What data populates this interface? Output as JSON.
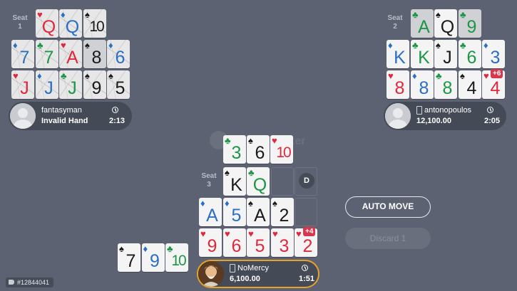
{
  "colors": {
    "table": "#5d6272",
    "red": "#e0283d",
    "black": "#1a1a1a",
    "blue": "#2a6fc4",
    "green": "#1d9647",
    "accent_gold": "#e7a22a",
    "badge_red": "#d8364c"
  },
  "watermark_text": "ter",
  "seats": [
    {
      "label_word": "Seat",
      "label_num": "1",
      "player": {
        "name": "fantasyman",
        "value": "Invalid Hand",
        "time": "2:13"
      },
      "cards": [
        {
          "rank": "Q",
          "suit": "♥",
          "color": "red",
          "row": 0,
          "col": 1,
          "state": "cracked"
        },
        {
          "rank": "Q",
          "suit": "♦",
          "color": "blue",
          "row": 0,
          "col": 2,
          "state": "cracked"
        },
        {
          "rank": "10",
          "suit": "♠",
          "color": "black",
          "row": 0,
          "col": 3,
          "state": "cracked"
        },
        {
          "rank": "7",
          "suit": "♦",
          "color": "blue",
          "row": 1,
          "col": 0,
          "state": "cracked"
        },
        {
          "rank": "7",
          "suit": "♣",
          "color": "green",
          "row": 1,
          "col": 1,
          "state": "cracked"
        },
        {
          "rank": "A",
          "suit": "♥",
          "color": "red",
          "row": 1,
          "col": 2,
          "state": "cracked"
        },
        {
          "rank": "8",
          "suit": "♠",
          "color": "black",
          "row": 1,
          "col": 3,
          "state": "dim"
        },
        {
          "rank": "6",
          "suit": "♦",
          "color": "blue",
          "row": 1,
          "col": 4,
          "state": "cracked"
        },
        {
          "rank": "J",
          "suit": "♥",
          "color": "red",
          "row": 2,
          "col": 0,
          "state": "cracked"
        },
        {
          "rank": "J",
          "suit": "♦",
          "color": "blue",
          "row": 2,
          "col": 1,
          "state": "cracked"
        },
        {
          "rank": "J",
          "suit": "♣",
          "color": "green",
          "row": 2,
          "col": 2,
          "state": "cracked"
        },
        {
          "rank": "9",
          "suit": "♠",
          "color": "black",
          "row": 2,
          "col": 3,
          "state": "cracked"
        },
        {
          "rank": "5",
          "suit": "♠",
          "color": "black",
          "row": 2,
          "col": 4,
          "state": "cracked"
        }
      ]
    },
    {
      "label_word": "Seat",
      "label_num": "2",
      "player": {
        "name": "antonopoulos",
        "value": "12,100.00",
        "time": "2:05"
      },
      "badge": "+6",
      "cards": [
        {
          "rank": "A",
          "suit": "♣",
          "color": "green",
          "row": 0,
          "col": 1,
          "state": "dim"
        },
        {
          "rank": "Q",
          "suit": "♠",
          "color": "black",
          "row": 0,
          "col": 2,
          "state": "normal"
        },
        {
          "rank": "9",
          "suit": "♣",
          "color": "green",
          "row": 0,
          "col": 3,
          "state": "dim"
        },
        {
          "rank": "K",
          "suit": "♦",
          "color": "blue",
          "row": 1,
          "col": 0,
          "state": "normal"
        },
        {
          "rank": "K",
          "suit": "♣",
          "color": "green",
          "row": 1,
          "col": 1,
          "state": "normal"
        },
        {
          "rank": "J",
          "suit": "♠",
          "color": "black",
          "row": 1,
          "col": 2,
          "state": "normal"
        },
        {
          "rank": "6",
          "suit": "♣",
          "color": "green",
          "row": 1,
          "col": 3,
          "state": "normal"
        },
        {
          "rank": "3",
          "suit": "♦",
          "color": "blue",
          "row": 1,
          "col": 4,
          "state": "normal"
        },
        {
          "rank": "8",
          "suit": "♥",
          "color": "red",
          "row": 2,
          "col": 0,
          "state": "normal"
        },
        {
          "rank": "8",
          "suit": "♦",
          "color": "blue",
          "row": 2,
          "col": 1,
          "state": "normal"
        },
        {
          "rank": "8",
          "suit": "♣",
          "color": "green",
          "row": 2,
          "col": 2,
          "state": "normal"
        },
        {
          "rank": "4",
          "suit": "♠",
          "color": "black",
          "row": 2,
          "col": 3,
          "state": "normal"
        },
        {
          "rank": "4",
          "suit": "♥",
          "color": "red",
          "row": 2,
          "col": 4,
          "state": "normal"
        }
      ]
    },
    {
      "label_word": "Seat",
      "label_num": "3",
      "player": {
        "name": "NoMercy",
        "value": "6,100.00",
        "time": "1:51"
      },
      "badge": "+4",
      "dealer": "D",
      "cards": [
        {
          "rank": "K",
          "suit": "♠",
          "color": "black",
          "row": 0,
          "col": 1,
          "state": "normal"
        },
        {
          "rank": "Q",
          "suit": "♣",
          "color": "green",
          "row": 0,
          "col": 2,
          "state": "normal"
        },
        {
          "rank": "A",
          "suit": "♦",
          "color": "blue",
          "row": 1,
          "col": 0,
          "state": "normal"
        },
        {
          "rank": "5",
          "suit": "♦",
          "color": "blue",
          "row": 1,
          "col": 1,
          "state": "normal"
        },
        {
          "rank": "A",
          "suit": "♠",
          "color": "black",
          "row": 1,
          "col": 2,
          "state": "normal"
        },
        {
          "rank": "2",
          "suit": "♠",
          "color": "black",
          "row": 1,
          "col": 3,
          "state": "normal"
        },
        {
          "rank": "9",
          "suit": "♥",
          "color": "red",
          "row": 2,
          "col": 0,
          "state": "normal"
        },
        {
          "rank": "6",
          "suit": "♥",
          "color": "red",
          "row": 2,
          "col": 1,
          "state": "normal"
        },
        {
          "rank": "5",
          "suit": "♥",
          "color": "red",
          "row": 2,
          "col": 2,
          "state": "normal"
        },
        {
          "rank": "3",
          "suit": "♥",
          "color": "red",
          "row": 2,
          "col": 3,
          "state": "normal"
        },
        {
          "rank": "2",
          "suit": "♥",
          "color": "red",
          "row": 2,
          "col": 4,
          "state": "normal"
        }
      ]
    }
  ],
  "dealt_cards": [
    {
      "rank": "3",
      "suit": "♣",
      "color": "green"
    },
    {
      "rank": "6",
      "suit": "♠",
      "color": "black"
    },
    {
      "rank": "10",
      "suit": "♥",
      "color": "red"
    }
  ],
  "side_hand": [
    {
      "rank": "7",
      "suit": "♠",
      "color": "black"
    },
    {
      "rank": "9",
      "suit": "♦",
      "color": "blue"
    },
    {
      "rank": "10",
      "suit": "♣",
      "color": "green"
    }
  ],
  "actions": {
    "auto_move": "AUTO MOVE",
    "discard": "Discard 1"
  },
  "hand_id": "#12844041"
}
